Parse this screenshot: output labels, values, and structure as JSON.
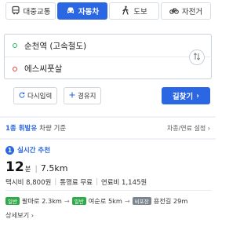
{
  "tabs": [
    {
      "label": "대중교통",
      "icon": "bus-icon",
      "active": false
    },
    {
      "label": "자동차",
      "icon": "car-icon",
      "active": true
    },
    {
      "label": "도보",
      "icon": "walk-icon",
      "active": false
    },
    {
      "label": "자전거",
      "icon": "bicycle-icon",
      "active": false
    }
  ],
  "route": {
    "start": "순천역 (고속철도)",
    "end": "에스씨풋살"
  },
  "buttons": {
    "reset": "다시입력",
    "waypoint": "경유지",
    "search": "길찾기"
  },
  "fuel": {
    "main": "1종 휘발유",
    "sub": "차량 기준",
    "setting": "차종/연료 설정"
  },
  "result": {
    "rank": "1",
    "label": "실시간 추천",
    "time_value": "12",
    "time_unit": "분",
    "distance": "7.5km",
    "taxi": "택시비 8,800원",
    "toll": "통행료 무료",
    "fuel_cost": "연료비 1,145원",
    "roads": [
      {
        "tag": "일반",
        "name": "팔마로 2.3km",
        "tag_color": "#2eaa49"
      },
      {
        "tag": "일반",
        "name": "여순로 5km",
        "tag_color": "#2eaa49"
      },
      {
        "tag": "비포장",
        "name": "용전길 29m",
        "tag_color": "#7a8590"
      }
    ],
    "detail": "상세보기"
  },
  "colors": {
    "accent": "#2b66e3",
    "start_dot": "#28b463",
    "end_dot": "#e0453a"
  }
}
